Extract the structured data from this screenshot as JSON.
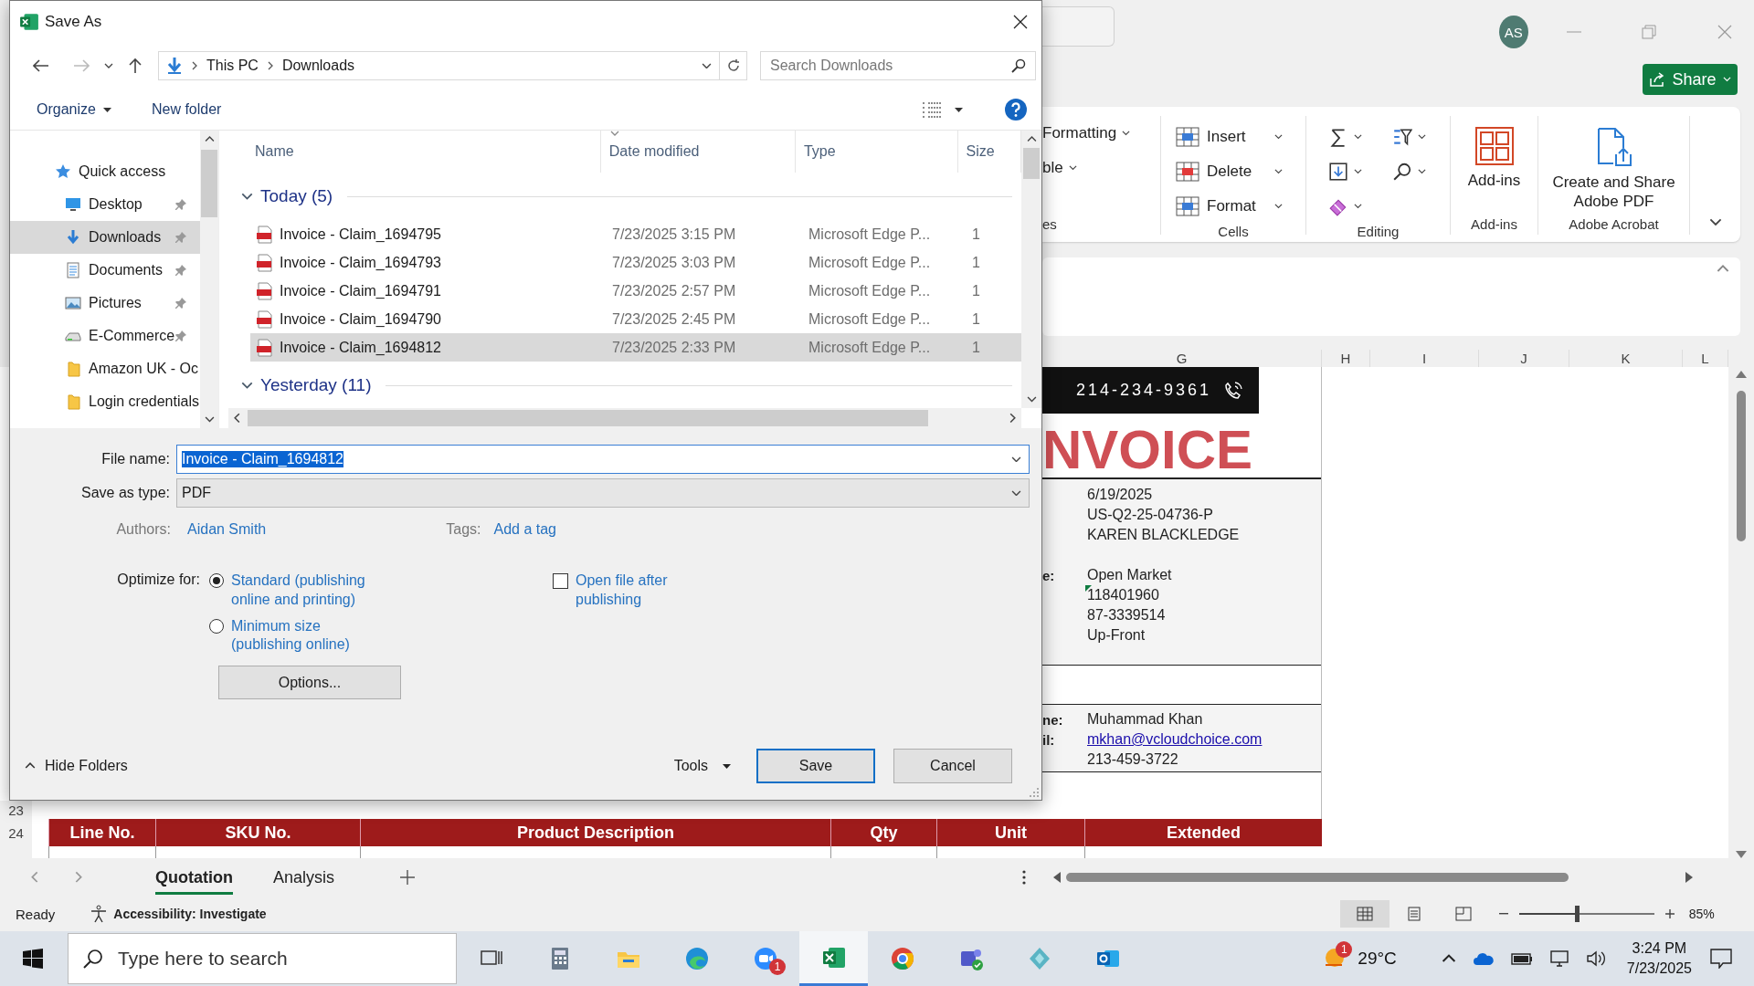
{
  "excel": {
    "account_initials": "AS",
    "share_button": "Share",
    "ribbon": {
      "cut_items": [
        "Formatting",
        "ble"
      ],
      "cut_group": "es",
      "cells": {
        "label": "Cells",
        "items": [
          {
            "label": "Insert",
            "kind": "insert"
          },
          {
            "label": "Delete",
            "kind": "delete"
          },
          {
            "label": "Format",
            "kind": "format"
          }
        ]
      },
      "editing": {
        "label": "Editing"
      },
      "addins": {
        "label": "Add-ins",
        "button": "Add-ins"
      },
      "acrobat": {
        "label": "Adobe Acrobat",
        "button": "Create and Share Adobe PDF"
      }
    },
    "columns": [
      "G",
      "H",
      "I",
      "J",
      "K",
      "L"
    ],
    "sheet": {
      "phone": "214-234-9361",
      "title": "NVOICE",
      "info_sections": [
        {
          "groups": [
            [
              {
                "kind": "text",
                "value": "6/19/2025"
              },
              {
                "kind": "text",
                "value": "US-Q2-25-04736-P"
              },
              {
                "kind": "text",
                "value": "KAREN BLACKLEDGE"
              }
            ],
            [
              {
                "kind": "text",
                "label": "e:",
                "value": "Open Market"
              },
              {
                "kind": "flagged",
                "value": "118401960"
              },
              {
                "kind": "text",
                "value": "87-3339514"
              },
              {
                "kind": "text",
                "value": "Up-Front"
              }
            ]
          ]
        },
        {
          "groups": [
            [
              {
                "kind": "text",
                "label": "ne:",
                "value": "Muhammad Khan"
              },
              {
                "kind": "link",
                "label": "il:",
                "value": "mkhan@vcloudchoice.com"
              },
              {
                "kind": "text",
                "value": "213-459-3722"
              }
            ]
          ]
        }
      ],
      "row_numbers": [
        "23",
        "24"
      ],
      "table_headers": [
        "Line No.",
        "SKU No.",
        "Product Description",
        "Qty",
        "Unit",
        "Extended"
      ]
    },
    "sheet_tabs": [
      {
        "label": "Quotation",
        "selected": true
      },
      {
        "label": "Analysis",
        "selected": false
      }
    ],
    "status": "Ready",
    "accessibility": "Accessibility: Investigate",
    "views": [
      {
        "kind": "normal",
        "selected": true
      },
      {
        "kind": "page-layout",
        "selected": false
      },
      {
        "kind": "page-break",
        "selected": false
      }
    ],
    "zoom": {
      "level": 0.43,
      "reading": "85%"
    }
  },
  "dialog": {
    "title": "Save As",
    "path": [
      "This PC",
      "Downloads"
    ],
    "search": {
      "placeholder": "Search Downloads"
    },
    "organize": "Organize",
    "new_folder": "New folder",
    "nav_tree": [
      {
        "label": "Quick access",
        "kind": "star",
        "pinned": false,
        "selected": false,
        "children": [
          {
            "label": "Desktop",
            "kind": "desktop",
            "pinned": true,
            "selected": false
          },
          {
            "label": "Downloads",
            "kind": "download",
            "pinned": true,
            "selected": true
          },
          {
            "label": "Documents",
            "kind": "document",
            "pinned": true,
            "selected": false
          },
          {
            "label": "Pictures",
            "kind": "picture",
            "pinned": true,
            "selected": false
          },
          {
            "label": "E-Commerce",
            "kind": "drive",
            "pinned": true,
            "selected": false
          },
          {
            "label": "Amazon UK - Oc",
            "kind": "folder",
            "pinned": false,
            "selected": false
          },
          {
            "label": "Login credentials",
            "kind": "folder",
            "pinned": false,
            "selected": false
          }
        ]
      }
    ],
    "columns": [
      "Name",
      "Date modified",
      "Type",
      "Size"
    ],
    "groups": [
      {
        "label": "Today (5)",
        "expanded": true,
        "files": [
          {
            "name": "Invoice - Claim_1694795",
            "date": "7/23/2025 3:15 PM",
            "type": "Microsoft Edge P...",
            "size": "1",
            "selected": false
          },
          {
            "name": "Invoice - Claim_1694793",
            "date": "7/23/2025 3:03 PM",
            "type": "Microsoft Edge P...",
            "size": "1",
            "selected": false
          },
          {
            "name": "Invoice - Claim_1694791",
            "date": "7/23/2025 2:57 PM",
            "type": "Microsoft Edge P...",
            "size": "1",
            "selected": false
          },
          {
            "name": "Invoice - Claim_1694790",
            "date": "7/23/2025 2:45 PM",
            "type": "Microsoft Edge P...",
            "size": "1",
            "selected": false
          },
          {
            "name": "Invoice - Claim_1694812",
            "date": "7/23/2025 2:33 PM",
            "type": "Microsoft Edge P...",
            "size": "1",
            "selected": true
          }
        ]
      },
      {
        "label": "Yesterday (11)",
        "expanded": true
      }
    ],
    "file_name": {
      "label": "File name:",
      "value": "Invoice - Claim_1694812"
    },
    "save_as_type": {
      "label": "Save as type:",
      "value": "PDF"
    },
    "authors": {
      "label": "Authors:",
      "value": "Aidan Smith"
    },
    "tags": {
      "label": "Tags:",
      "value": "Add a tag"
    },
    "optimize": {
      "label": "Optimize for:",
      "options": [
        {
          "label": "Standard (publishing online and printing)",
          "selected": true
        },
        {
          "label": "Minimum size (publishing online)",
          "selected": false
        }
      ]
    },
    "open_after": {
      "label": "Open file after publishing",
      "checked": false
    },
    "options_button": "Options...",
    "hide_folders": "Hide Folders",
    "tools": "Tools",
    "buttons": [
      "Save",
      "Cancel"
    ]
  },
  "taskbar": {
    "search": {
      "placeholder": "Type here to search"
    },
    "apps": [
      {
        "kind": "task-view",
        "active": false
      },
      {
        "kind": "calculator",
        "active": false
      },
      {
        "kind": "file-explorer",
        "active": false
      },
      {
        "kind": "edge",
        "active": false
      },
      {
        "kind": "zoom",
        "active": false,
        "badge": "1"
      },
      {
        "kind": "excel",
        "active": true
      },
      {
        "kind": "chrome",
        "active": false
      },
      {
        "kind": "teams",
        "active": false
      },
      {
        "kind": "app",
        "active": false
      },
      {
        "kind": "outlook",
        "active": false
      }
    ],
    "weather": {
      "temperature": "29°C",
      "badge": "1"
    },
    "time": "3:24 PM",
    "date": "7/23/2025"
  }
}
